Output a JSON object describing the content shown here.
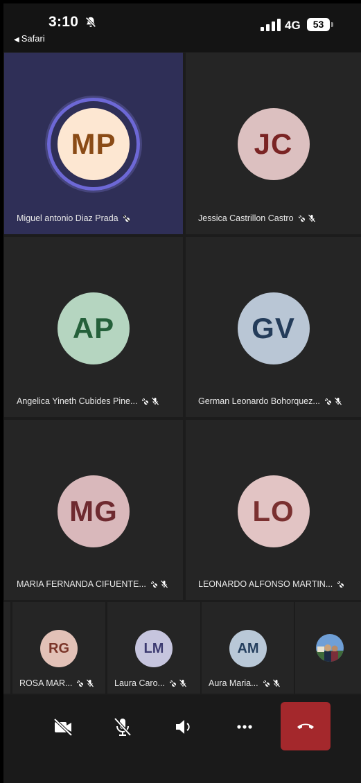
{
  "status_bar": {
    "time": "3:10",
    "back_label": "Safari",
    "network": "4G",
    "battery": "53"
  },
  "participants": [
    {
      "initials": "MP",
      "name": "Miguel antonio Diaz Prada",
      "bg": "#fde7d2",
      "fg": "#8a4b16",
      "speaking": true,
      "muted": false
    },
    {
      "initials": "JC",
      "name": "Jessica Castrillon Castro",
      "bg": "#dcc0c0",
      "fg": "#7a2424",
      "speaking": false,
      "muted": true
    },
    {
      "initials": "AP",
      "name": "Angelica Yineth Cubides Pine...",
      "bg": "#b5d5c0",
      "fg": "#24603a",
      "speaking": false,
      "muted": true
    },
    {
      "initials": "GV",
      "name": "German Leonardo Bohorquez...",
      "bg": "#b9c6d5",
      "fg": "#243c5a",
      "speaking": false,
      "muted": true
    },
    {
      "initials": "MG",
      "name": "MARIA FERNANDA CIFUENTE...",
      "bg": "#d9b8bb",
      "fg": "#6e2a30",
      "speaking": false,
      "muted": true
    },
    {
      "initials": "LO",
      "name": "LEONARDO ALFONSO MARTIN...",
      "bg": "#e2c4c4",
      "fg": "#7a3030",
      "speaking": false,
      "muted": false
    }
  ],
  "small_participants": [
    {
      "initials": "RG",
      "name": "ROSA MAR...",
      "bg": "#e2c1b7",
      "fg": "#7a3428"
    },
    {
      "initials": "LM",
      "name": "Laura Caro...",
      "bg": "#c6c5de",
      "fg": "#3c3a70"
    },
    {
      "initials": "AM",
      "name": "Aura Maria...",
      "bg": "#b9c8d7",
      "fg": "#253f5e"
    }
  ],
  "controls": {
    "camera": "camera-off-icon",
    "mic": "mic-off-icon",
    "speaker": "speaker-icon",
    "more": "more-icon",
    "hangup": "hang-up-icon"
  },
  "colors": {
    "speaking_tile": "#2f2f57",
    "speaking_ring": "#6d68d6",
    "hangup": "#a4282c"
  }
}
